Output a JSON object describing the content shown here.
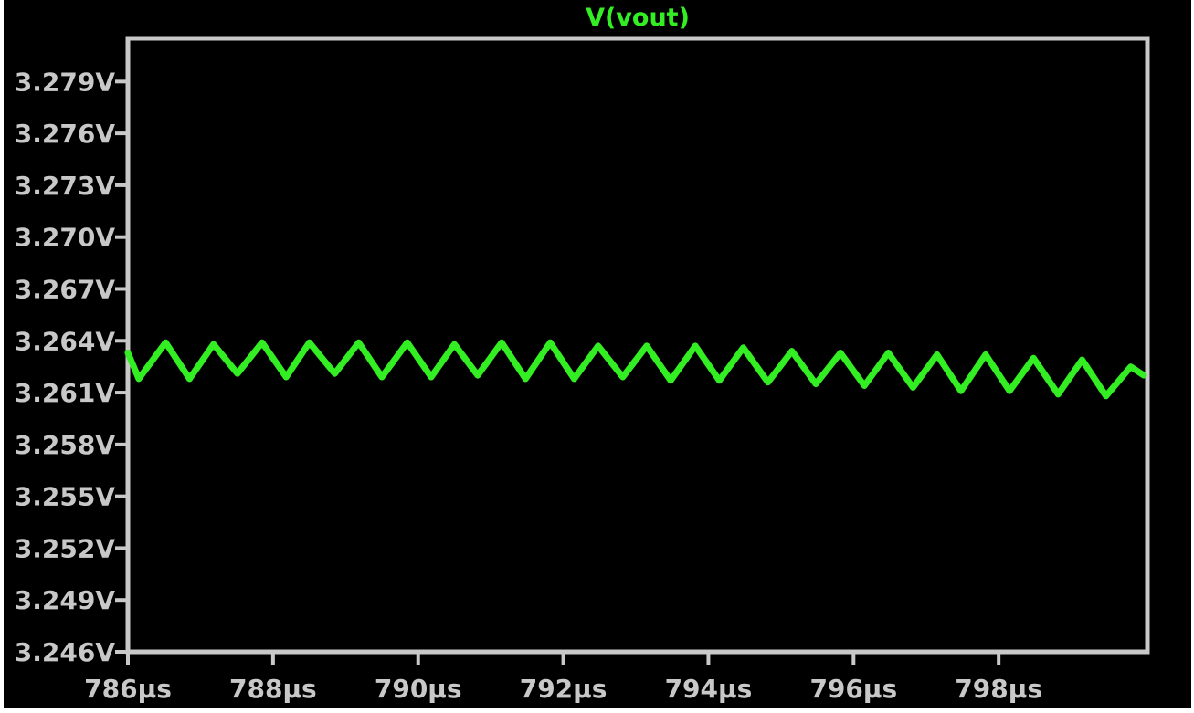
{
  "chart_data": {
    "type": "line",
    "title": "V(vout)",
    "xlabel": "",
    "ylabel": "",
    "x_unit": "µs",
    "y_unit": "V",
    "xlim": [
      786,
      800.05
    ],
    "ylim": [
      3.246,
      3.2815
    ],
    "x_ticks": [
      786,
      788,
      790,
      792,
      794,
      796,
      798
    ],
    "x_tick_labels": [
      "786µs",
      "788µs",
      "790µs",
      "792µs",
      "794µs",
      "796µs",
      "798µs"
    ],
    "y_ticks": [
      3.279,
      3.276,
      3.273,
      3.27,
      3.267,
      3.264,
      3.261,
      3.258,
      3.255,
      3.252,
      3.249,
      3.246
    ],
    "y_tick_labels": [
      "3.279V",
      "3.276V",
      "3.273V",
      "3.270V",
      "3.267V",
      "3.264V",
      "3.261V",
      "3.258V",
      "3.255V",
      "3.252V",
      "3.249V",
      "3.246V"
    ],
    "grid": false,
    "background": "#000000",
    "frame_color": "#c8c8c8",
    "series": [
      {
        "name": "V(vout)",
        "color": "#33ee22",
        "points": [
          [
            786.0,
            3.2633
          ],
          [
            786.15,
            3.2618
          ],
          [
            786.52,
            3.2639
          ],
          [
            786.85,
            3.2618
          ],
          [
            787.18,
            3.2638
          ],
          [
            787.51,
            3.2621
          ],
          [
            787.85,
            3.2639
          ],
          [
            788.18,
            3.2619
          ],
          [
            788.5,
            3.2639
          ],
          [
            788.85,
            3.2621
          ],
          [
            789.18,
            3.2639
          ],
          [
            789.5,
            3.2619
          ],
          [
            789.85,
            3.2639
          ],
          [
            790.18,
            3.2619
          ],
          [
            790.5,
            3.2638
          ],
          [
            790.82,
            3.262
          ],
          [
            791.15,
            3.2639
          ],
          [
            791.48,
            3.2618
          ],
          [
            791.82,
            3.2639
          ],
          [
            792.15,
            3.2618
          ],
          [
            792.48,
            3.2637
          ],
          [
            792.82,
            3.2619
          ],
          [
            793.15,
            3.2637
          ],
          [
            793.48,
            3.2617
          ],
          [
            793.82,
            3.2637
          ],
          [
            794.15,
            3.2617
          ],
          [
            794.48,
            3.2636
          ],
          [
            794.82,
            3.2616
          ],
          [
            795.15,
            3.2634
          ],
          [
            795.48,
            3.2615
          ],
          [
            795.82,
            3.2633
          ],
          [
            796.15,
            3.2614
          ],
          [
            796.48,
            3.2633
          ],
          [
            796.82,
            3.2613
          ],
          [
            797.15,
            3.2632
          ],
          [
            797.48,
            3.2611
          ],
          [
            797.82,
            3.2632
          ],
          [
            798.15,
            3.2611
          ],
          [
            798.48,
            3.263
          ],
          [
            798.82,
            3.2609
          ],
          [
            799.15,
            3.2629
          ],
          [
            799.48,
            3.2608
          ],
          [
            799.82,
            3.2625
          ],
          [
            800.0,
            3.262
          ]
        ]
      }
    ]
  }
}
